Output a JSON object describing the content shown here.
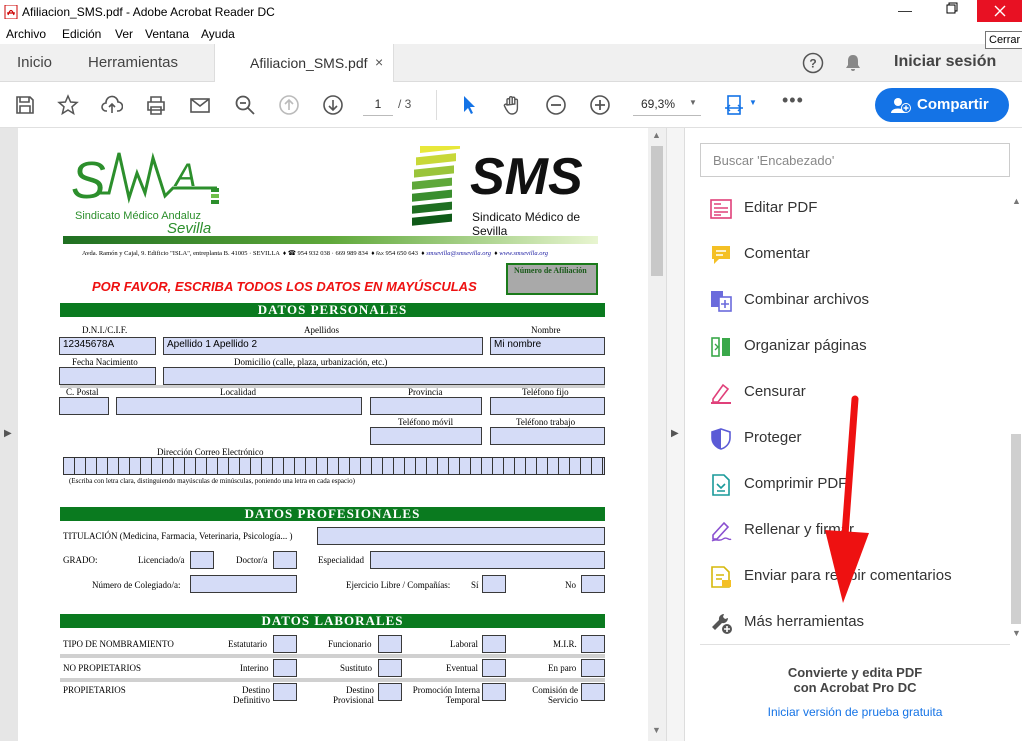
{
  "window": {
    "title": "Afiliacion_SMS.pdf - Adobe Acrobat Reader DC",
    "close_tooltip": "Cerrar"
  },
  "menu": [
    "Archivo",
    "Edición",
    "Ver",
    "Ventana",
    "Ayuda"
  ],
  "tabs": {
    "home": "Inicio",
    "tools": "Herramientas",
    "doc": "Afiliacion_SMS.pdf",
    "sign_in": "Iniciar sesión"
  },
  "toolbar": {
    "page_current": "1",
    "page_total": "/ 3",
    "zoom": "69,3%",
    "share": "Compartir"
  },
  "right_panel": {
    "search_placeholder": "Buscar 'Encabezado'",
    "tools": [
      "Editar PDF",
      "Comentar",
      "Combinar archivos",
      "Organizar páginas",
      "Censurar",
      "Proteger",
      "Comprimir PDF",
      "Rellenar y firmar",
      "Enviar para recibir comentarios",
      "Más herramientas"
    ],
    "promo_line1": "Convierte y edita PDF",
    "promo_line2": "con Acrobat Pro DC",
    "promo_link": "Iniciar versión de prueba gratuita"
  },
  "doc": {
    "sma_brand": "Sindicato Médico Andaluz",
    "sma_city": "Sevilla",
    "sms_logo": "SMS",
    "sms_sub": "Sindicato Médico de Sevilla",
    "address": "Avda. Ramón y Cajal, 9. Edificio \"ISLA\", entreplanta B. 41005 · SEVILLA",
    "phone": "954 932 038 · 669 989 834",
    "fax": "954 650 643",
    "email": "smsevilla@smsevilla.org",
    "web": "www.smsevilla.org",
    "notice": "POR FAVOR, ESCRIBA TODOS LOS DATOS EN MAYÚSCULAS",
    "afiliacion_label": "Número de Afiliación",
    "sec_personal": "DATOS PERSONALES",
    "sec_profesional": "DATOS PROFESIONALES",
    "sec_laboral": "DATOS LABORALES",
    "lbl_dni": "D.N.I./C.I.F.",
    "lbl_apellidos": "Apellidos",
    "lbl_nombre": "Nombre",
    "val_dni": "12345678A",
    "val_apellidos": "Apellido 1 Apellido 2",
    "val_nombre": "Mi nombre",
    "lbl_fnac": "Fecha Nacimiento",
    "lbl_domicilio": "Domicilio (calle, plaza, urbanización, etc.)",
    "lbl_cp": "C. Postal",
    "lbl_localidad": "Localidad",
    "lbl_provincia": "Provincia",
    "lbl_tfijo": "Teléfono fijo",
    "lbl_tmovil": "Teléfono móvil",
    "lbl_ttrabajo": "Teléfono trabajo",
    "lbl_email": "Dirección Correo Electrónico",
    "lbl_email_note": "(Escriba con letra clara, distinguiendo mayúsculas de minúsculas, poniendo una letra en cada espacio)",
    "lbl_titulacion": "TITULACIÓN (Medicina, Farmacia, Veterinaria, Psicología... )",
    "lbl_grado": "GRADO:",
    "lbl_licenciado": "Licenciado/a",
    "lbl_doctor": "Doctor/a",
    "lbl_especialidad": "Especialidad",
    "lbl_colegiado": "Número de Colegiado/a:",
    "lbl_ejercicio": "Ejercicio Libre / Compañías:",
    "lbl_si": "Sí",
    "lbl_no": "No",
    "lbl_tipo": "TIPO DE NOMBRAMIENTO",
    "lbl_estatutario": "Estatutario",
    "lbl_funcionario": "Funcionario",
    "lbl_laboral": "Laboral",
    "lbl_mir": "M.I.R.",
    "lbl_noprop": "NO PROPIETARIOS",
    "lbl_interino": "Interino",
    "lbl_sustituto": "Sustituto",
    "lbl_eventual": "Eventual",
    "lbl_paro": "En paro",
    "lbl_prop": "PROPIETARIOS",
    "lbl_destdef1": "Destino",
    "lbl_destdef2": "Definitivo",
    "lbl_destprov1": "Destino",
    "lbl_destprov2": "Provisional",
    "lbl_promo1": "Promoción Interna",
    "lbl_promo2": "Temporal",
    "lbl_comision1": "Comisión de",
    "lbl_comision2": "Servicio"
  },
  "colors": {
    "accent": "#1473e6",
    "section_green": "#0a7a1f",
    "field_fill": "#d5dcf7",
    "annotation_red": "#ee1111"
  }
}
